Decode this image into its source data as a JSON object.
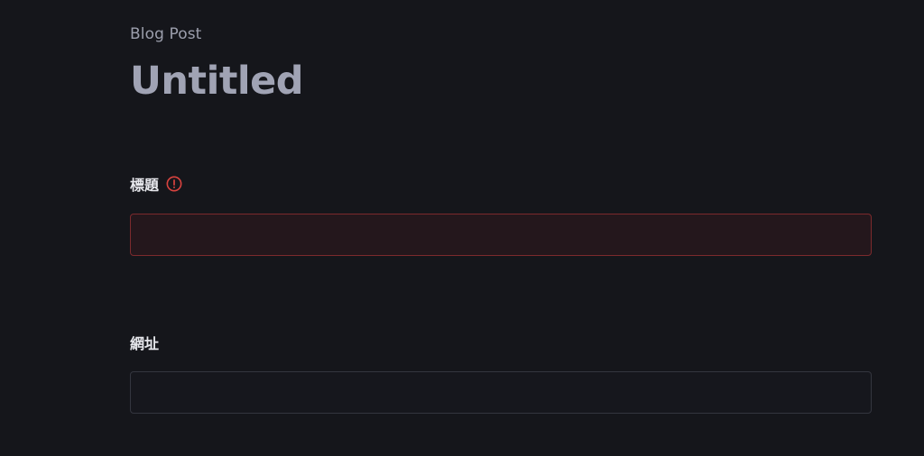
{
  "header": {
    "document_type": "Blog Post",
    "title": "Untitled"
  },
  "fields": {
    "title_field": {
      "label": "標題",
      "value": "",
      "status": "error",
      "status_icon": "error-icon"
    },
    "url_field": {
      "label": "網址",
      "value": ""
    }
  },
  "colors": {
    "background": "#15161b",
    "error": "#d9433f",
    "error_fill": "#24171c"
  }
}
